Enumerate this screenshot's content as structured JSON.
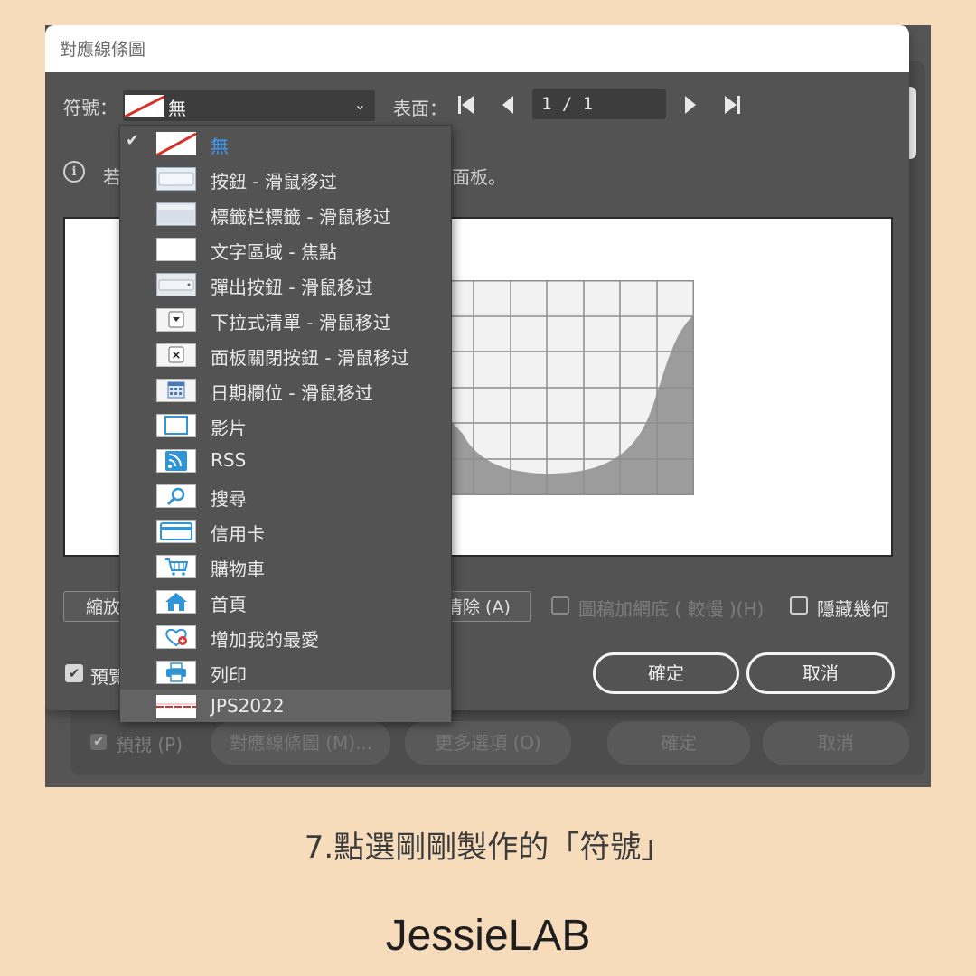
{
  "dialog": {
    "title": "對應線條圖",
    "symbol_label": "符號：",
    "symbol_value": "無",
    "surface_label": "表面：",
    "page": "1 / 1",
    "info_text_visible_start": "若",
    "info_text_visible_end": "面板。",
    "scale_button": "縮放",
    "clear_button": "清除 (A)",
    "draft_checkbox": "圖稿加網底 ( 較慢 )(H)",
    "hide_geometry_checkbox": "隱藏幾何",
    "preview_checkbox": "預覽",
    "ok_button": "確定",
    "cancel_button": "取消"
  },
  "background_dialog": {
    "preview_checkbox": "預視 (P)",
    "map_art_button": "對應線條圖 (M)...",
    "more_options_button": "更多選項 (O)",
    "ok_button": "確定",
    "cancel_button": "取消"
  },
  "symbol_menu": {
    "items": [
      {
        "label": "無",
        "icon": "none-swatch",
        "selected": true
      },
      {
        "label": "按鈕 - 滑鼠移过",
        "icon": "button-thumb"
      },
      {
        "label": "標籤栏標籤 - 滑鼠移过",
        "icon": "tab-thumb"
      },
      {
        "label": "文字區域 - 焦點",
        "icon": "textarea-thumb"
      },
      {
        "label": "彈出按鈕 - 滑鼠移过",
        "icon": "popup-button-thumb"
      },
      {
        "label": "下拉式清單 - 滑鼠移过",
        "icon": "dropdown-thumb"
      },
      {
        "label": "面板關閉按鈕 - 滑鼠移过",
        "icon": "close-thumb"
      },
      {
        "label": "日期欄位 - 滑鼠移过",
        "icon": "calendar-thumb"
      },
      {
        "label": "影片",
        "icon": "video-thumb"
      },
      {
        "label": "RSS",
        "icon": "rss-thumb"
      },
      {
        "label": "搜尋",
        "icon": "search-thumb"
      },
      {
        "label": "信用卡",
        "icon": "credit-card-thumb"
      },
      {
        "label": "購物車",
        "icon": "cart-thumb"
      },
      {
        "label": "首頁",
        "icon": "home-thumb"
      },
      {
        "label": "增加我的最愛",
        "icon": "favorite-add-thumb"
      },
      {
        "label": "列印",
        "icon": "print-thumb"
      },
      {
        "label": "JPS2022",
        "icon": "custom-symbol-thumb",
        "highlighted": true
      }
    ]
  },
  "caption": "7.點選剛剛製作的「符號」",
  "brand": "JessieLAB",
  "colors": {
    "page_bg": "#f7dcbc",
    "dialog_bg": "#535353",
    "selected_text": "#3f9bf4",
    "icon_blue": "#2f95d6"
  }
}
